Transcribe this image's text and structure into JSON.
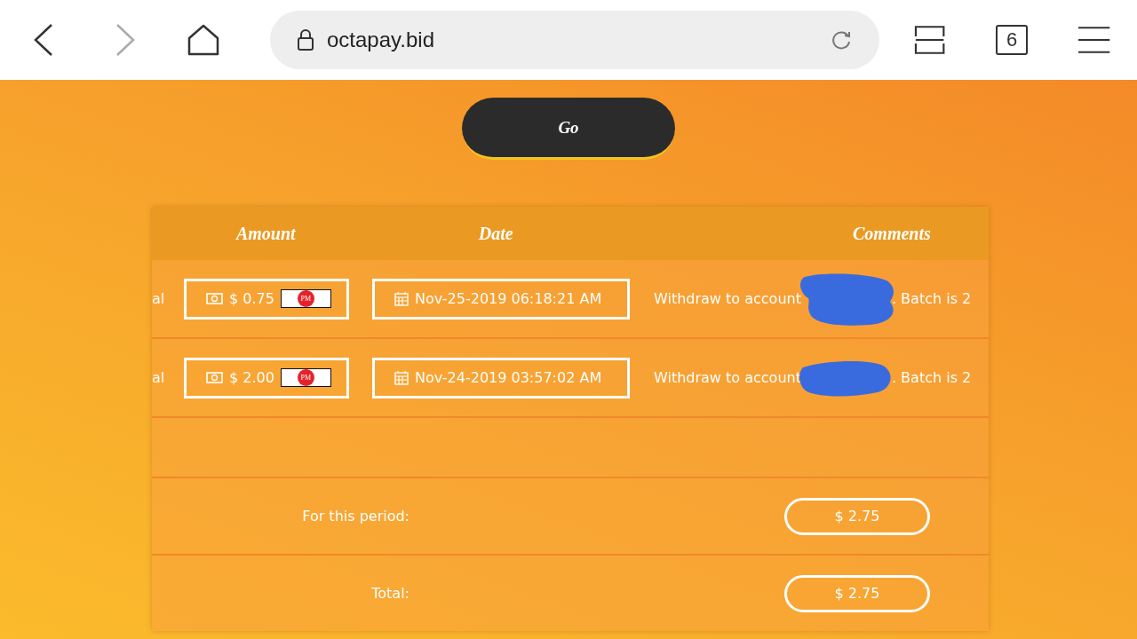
{
  "browser": {
    "back_disabled": false,
    "forward_disabled": true,
    "url": "octapay.bid",
    "tab_count": "6"
  },
  "go_button": {
    "label": "Go"
  },
  "table": {
    "columns": [
      "Amount",
      "Date",
      "Comments"
    ],
    "rows": [
      {
        "column_1": "al",
        "amount": "$ 0.75",
        "badge": "PM",
        "date": "Nov-25-2019 06:18:21 AM",
        "comment_before": "Withdraw to account",
        "comment_after": ". Batch is 2"
      },
      {
        "column_1": "al",
        "amount": "$ 2.00",
        "badge": "PM",
        "date": "Nov-24-2019 03:57:02 AM",
        "comment_before": "Withdraw to account",
        "comment_after": ". Batch is 2"
      }
    ],
    "summary": [
      {
        "label": "For this period:",
        "value": "$ 2.75"
      },
      {
        "label": "Total:",
        "value": "$ 2.75"
      }
    ]
  }
}
